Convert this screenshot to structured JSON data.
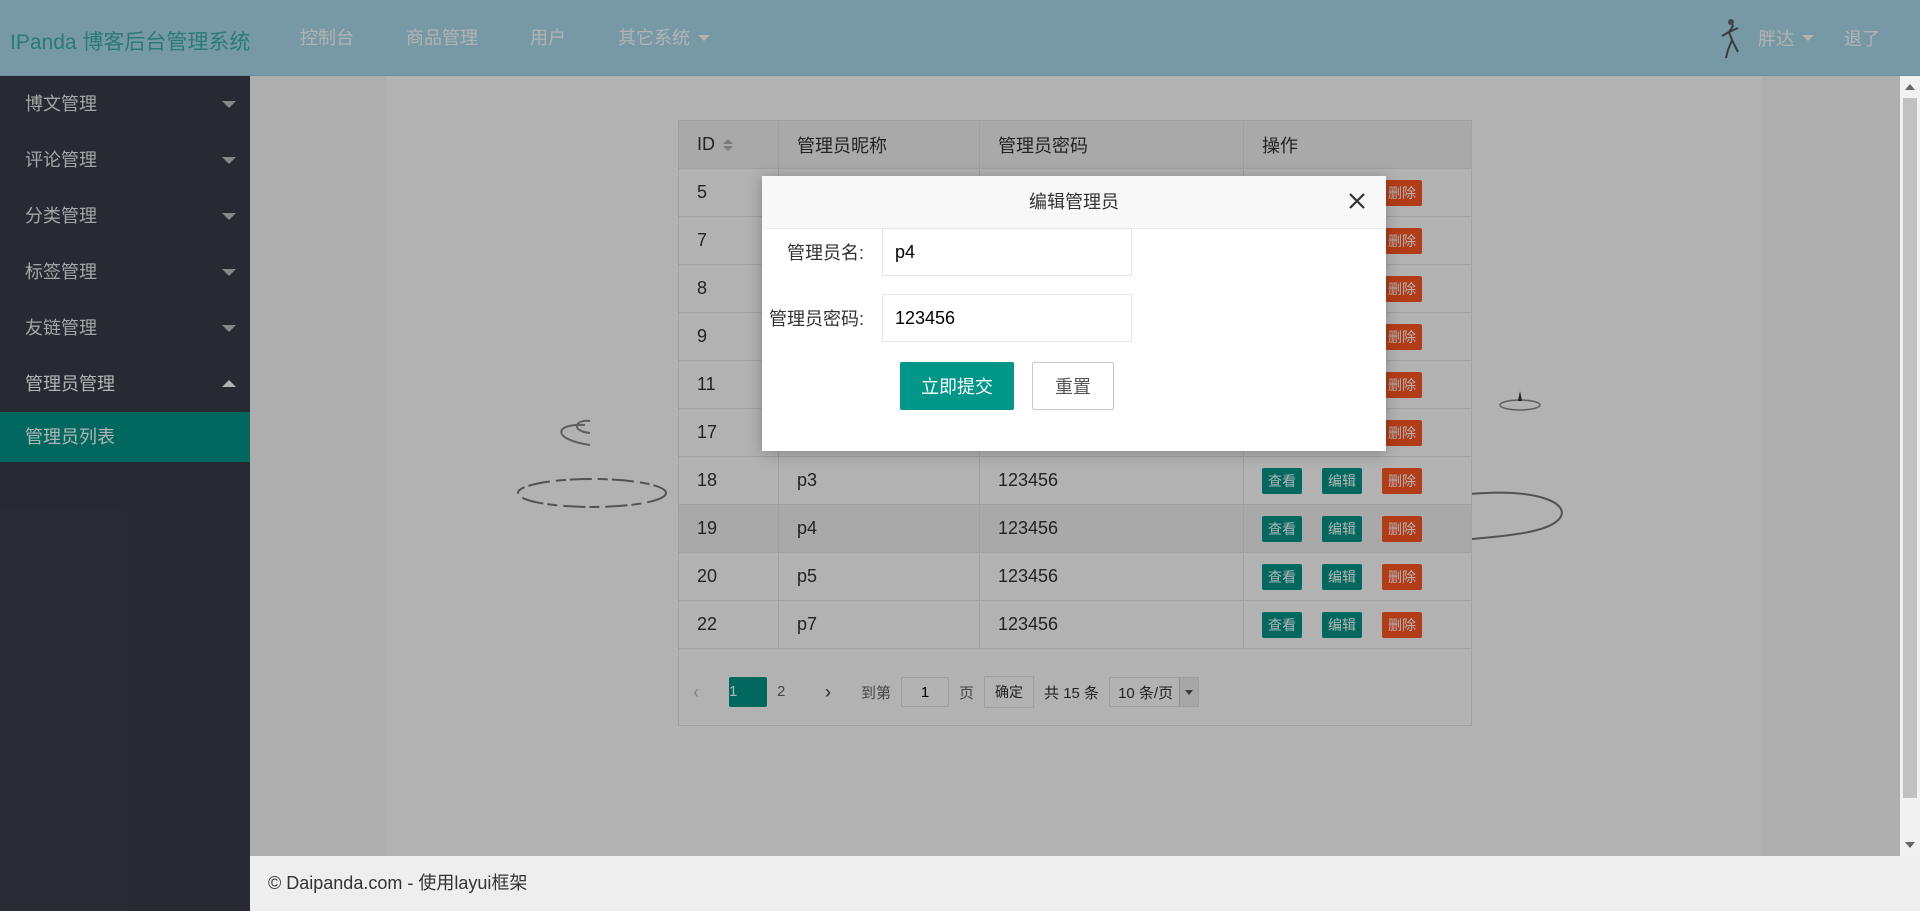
{
  "header": {
    "logo": "IPanda 博客后台管理系统",
    "nav": [
      {
        "label": "控制台"
      },
      {
        "label": "商品管理"
      },
      {
        "label": "用户"
      },
      {
        "label": "其它系统"
      }
    ],
    "user_name": "胖达",
    "logout": "退了"
  },
  "sidebar": {
    "items": [
      {
        "label": "博文管理"
      },
      {
        "label": "评论管理"
      },
      {
        "label": "分类管理"
      },
      {
        "label": "标签管理"
      },
      {
        "label": "友链管理"
      },
      {
        "label": "管理员管理"
      }
    ],
    "sub_item": "管理员列表"
  },
  "table": {
    "headers": [
      "ID",
      "管理员昵称",
      "管理员密码",
      "操作"
    ],
    "rows": [
      {
        "id": "5",
        "name": "",
        "pwd": ""
      },
      {
        "id": "7",
        "name": "",
        "pwd": ""
      },
      {
        "id": "8",
        "name": "",
        "pwd": ""
      },
      {
        "id": "9",
        "name": "",
        "pwd": ""
      },
      {
        "id": "11",
        "name": "",
        "pwd": ""
      },
      {
        "id": "17",
        "name": "",
        "pwd": ""
      },
      {
        "id": "18",
        "name": "p3",
        "pwd": "123456"
      },
      {
        "id": "19",
        "name": "p4",
        "pwd": "123456"
      },
      {
        "id": "20",
        "name": "p5",
        "pwd": "123456"
      },
      {
        "id": "22",
        "name": "p7",
        "pwd": "123456"
      }
    ],
    "actions": {
      "view": "查看",
      "edit": "编辑",
      "delete": "删除"
    }
  },
  "pager": {
    "pages": [
      "1",
      "2"
    ],
    "goto_label": "到第",
    "goto_value": "1",
    "page_unit": "页",
    "confirm": "确定",
    "total": "共 15 条",
    "page_size": "10 条/页"
  },
  "modal": {
    "title": "编辑管理员",
    "name_label": "管理员名:",
    "name_value": "p4",
    "pwd_label": "管理员密码:",
    "pwd_value": "123456",
    "submit": "立即提交",
    "reset": "重置"
  },
  "footer": "© Daipanda.com - 使用layui框架",
  "colors": {
    "accent": "#009688",
    "danger": "#ff5722",
    "header_bg": "#abdcee",
    "sidebar_bg": "#393d49"
  }
}
